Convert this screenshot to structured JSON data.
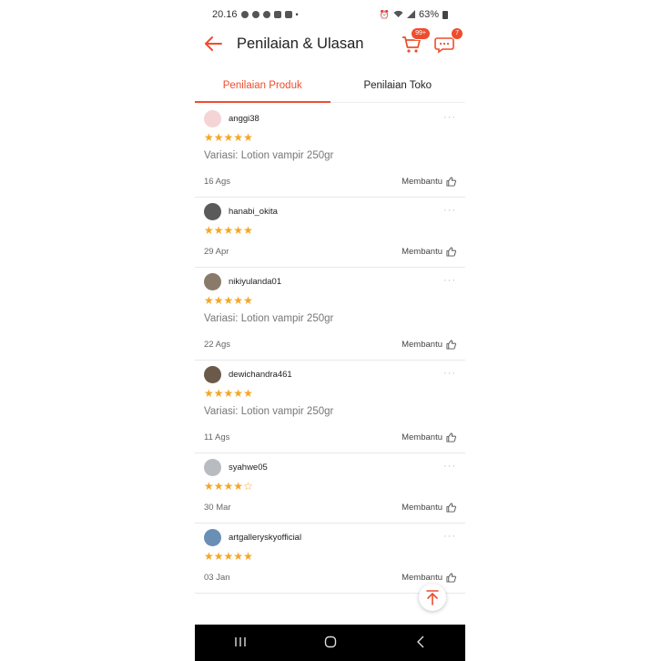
{
  "status_bar": {
    "time": "20.16",
    "battery": "63%"
  },
  "header": {
    "title": "Penilaian & Ulasan",
    "cart_badge": "99+",
    "chat_badge": "7"
  },
  "tabs": [
    {
      "label": "Penilaian Produk",
      "active": true
    },
    {
      "label": "Penilaian Toko",
      "active": false
    }
  ],
  "reviews": [
    {
      "username": "anggi38",
      "rating": 5,
      "variation": "Variasi: Lotion vampir 250gr",
      "date": "16 Ags",
      "helpful_label": "Membantu",
      "avatar_color": "#f4d4d4"
    },
    {
      "username": "hanabi_okita",
      "rating": 5,
      "variation": "",
      "date": "29 Apr",
      "helpful_label": "Membantu",
      "avatar_color": "#5a5a5a"
    },
    {
      "username": "nikiyulanda01",
      "rating": 5,
      "variation": "Variasi: Lotion vampir 250gr",
      "date": "22 Ags",
      "helpful_label": "Membantu",
      "avatar_color": "#8a7a6a"
    },
    {
      "username": "dewichandra461",
      "rating": 5,
      "variation": "Variasi: Lotion vampir 250gr",
      "date": "11 Ags",
      "helpful_label": "Membantu",
      "avatar_color": "#6b5a4a"
    },
    {
      "username": "syahwe05",
      "rating": 4,
      "variation": "",
      "date": "30 Mar",
      "helpful_label": "Membantu",
      "avatar_color": "#b8bcc0"
    },
    {
      "username": "artgalleryskyofficial",
      "rating": 5,
      "variation": "",
      "date": "03 Jan",
      "helpful_label": "Membantu",
      "avatar_color": "#6a8fb5"
    }
  ],
  "colors": {
    "accent": "#ee4d2d",
    "star": "#f5a623"
  },
  "icons": {
    "back": "arrow-left-icon",
    "cart": "cart-icon",
    "chat": "chat-icon",
    "more": "more-dots-icon",
    "thumb": "thumbs-up-icon",
    "scroll_top": "arrow-up-icon"
  }
}
